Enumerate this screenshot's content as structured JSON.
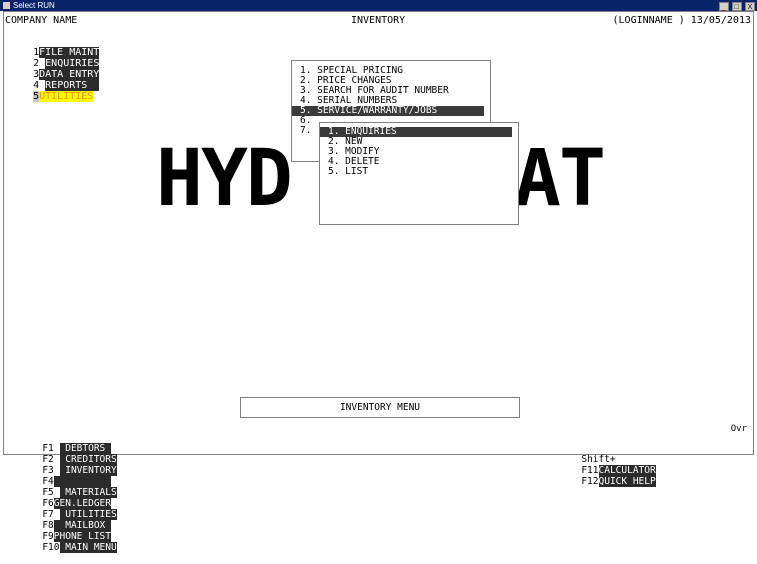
{
  "window": {
    "title": "Select RUN",
    "buttons": [
      "_",
      "□",
      "X"
    ]
  },
  "header": {
    "company": "COMPANY NAME",
    "module": "INVENTORY",
    "login": "(LOGINNAME ) 13/05/2013"
  },
  "menubar": [
    {
      "key": "1",
      "label": "FILE MAINT"
    },
    {
      "key": "2",
      "label": "ENQUIRIES"
    },
    {
      "key": "3",
      "label": "DATA ENTRY"
    },
    {
      "key": "4",
      "label": "REPORTS"
    },
    {
      "key": "5",
      "label": "UTILITIES"
    }
  ],
  "background_logo": {
    "left": "HYD",
    "right": "AT"
  },
  "utilities_menu": {
    "items": [
      "1. SPECIAL PRICING",
      "2. PRICE CHANGES",
      "3. SEARCH FOR AUDIT NUMBER",
      "4. SERIAL NUMBERS",
      "5. SERVICE/WARRANTY/JOBS",
      "6.",
      "7."
    ],
    "selected_index": 4
  },
  "service_submenu": {
    "items": [
      "1. ENQUIRIES",
      "2. NEW",
      "3. MODIFY",
      "4. DELETE",
      "5. LIST"
    ],
    "selected_index": 0
  },
  "status": {
    "menu_name": "INVENTORY MENU",
    "mode": "Ovr"
  },
  "function_keys": {
    "f1": {
      "key": "F1",
      "label": " DEBTORS "
    },
    "f2": {
      "key": "F2",
      "label": " CREDITORS"
    },
    "f3": {
      "key": "F3",
      "label": " INVENTORY"
    },
    "f4": {
      "key": "F4",
      "label": "          "
    },
    "f5": {
      "key": "F5",
      "label": " MATERIALS"
    },
    "f6": {
      "key": "F6",
      "label": "GEN.LEDGER"
    },
    "f7": {
      "key": "F7",
      "label": " UTILITIES"
    },
    "f8": {
      "key": "F8",
      "label": "  MAILBOX "
    },
    "f9": {
      "key": "F9",
      "label": "PHONE LIST"
    },
    "f10": {
      "key": "F10",
      "label": " MAIN MENU"
    },
    "shift_prefix": "Shift+",
    "f11": {
      "key": "F11",
      "label": "CALCULATOR"
    },
    "f12": {
      "key": "F12",
      "label": "QUICK HELP"
    }
  }
}
